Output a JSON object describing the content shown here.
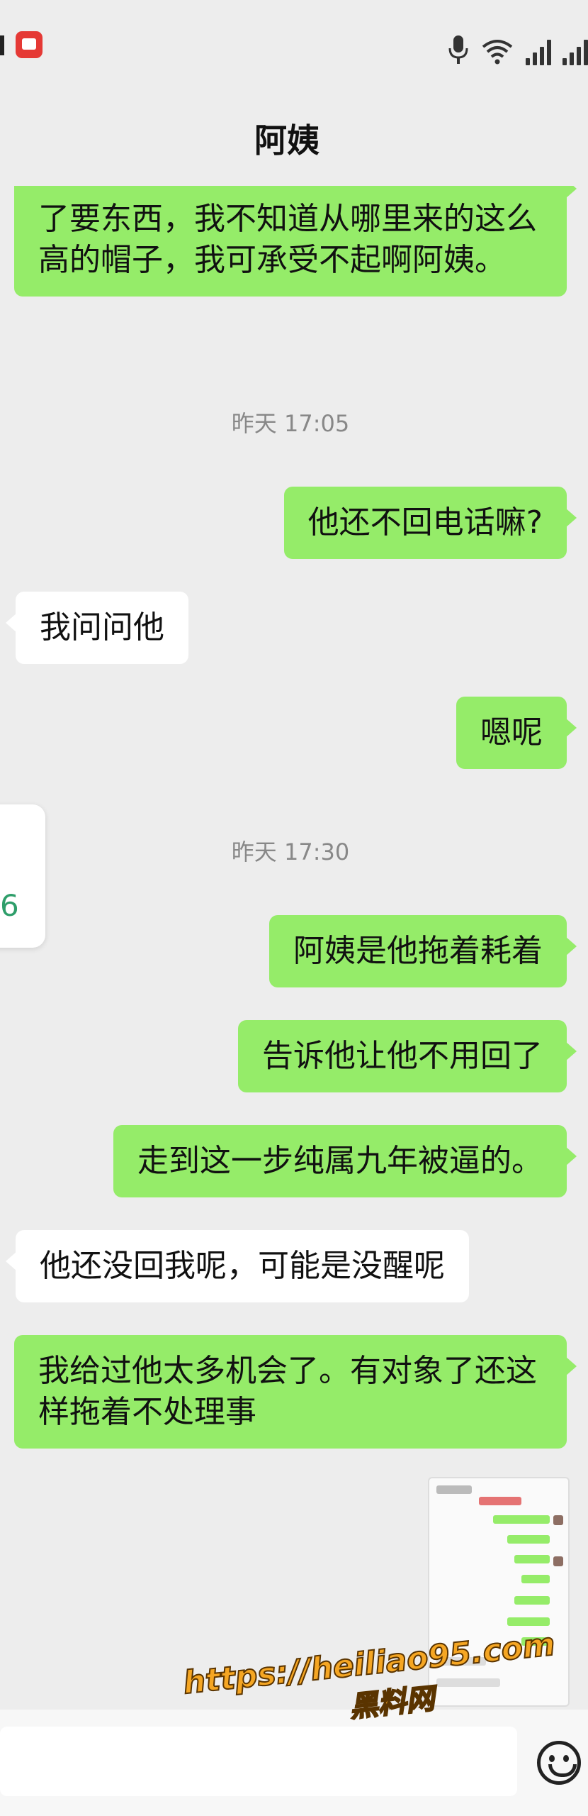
{
  "status_bar": {
    "icons": [
      "mic-icon",
      "wifi-icon",
      "signal-icon",
      "signal-icon"
    ]
  },
  "header": {
    "title": "阿姨"
  },
  "messages": [
    {
      "side": "out",
      "text": "了要东西，我不知道从哪里来的这么高的帽子，我可承受不起啊阿姨。"
    },
    {
      "side": "time",
      "text": "昨天 17:05"
    },
    {
      "side": "out",
      "text": "他还不回电话嘛?"
    },
    {
      "side": "in",
      "text": "我问问他"
    },
    {
      "side": "out",
      "text": "嗯呢"
    },
    {
      "side": "time",
      "text": "昨天 17:30"
    },
    {
      "side": "out",
      "text": "阿姨是他拖着耗着"
    },
    {
      "side": "out",
      "text": "告诉他让他不用回了"
    },
    {
      "side": "out",
      "text": "走到这一步纯属九年被逼的。"
    },
    {
      "side": "in",
      "text": "他还没回我呢，可能是没醒呢"
    },
    {
      "side": "out",
      "text": "我给过他太多机会了。有对象了还这样拖着不处理事"
    }
  ],
  "side_card": {
    "text": "6"
  },
  "image_message": {
    "icon": "screenshot-thumbnail"
  },
  "watermark": {
    "url": "https://heiliao95.com",
    "name": "黑料网"
  },
  "input_bar": {
    "emoji_icon": "emoji-icon"
  },
  "colors": {
    "outgoing": "#95ec69",
    "incoming": "#ffffff",
    "background": "#ededed"
  }
}
